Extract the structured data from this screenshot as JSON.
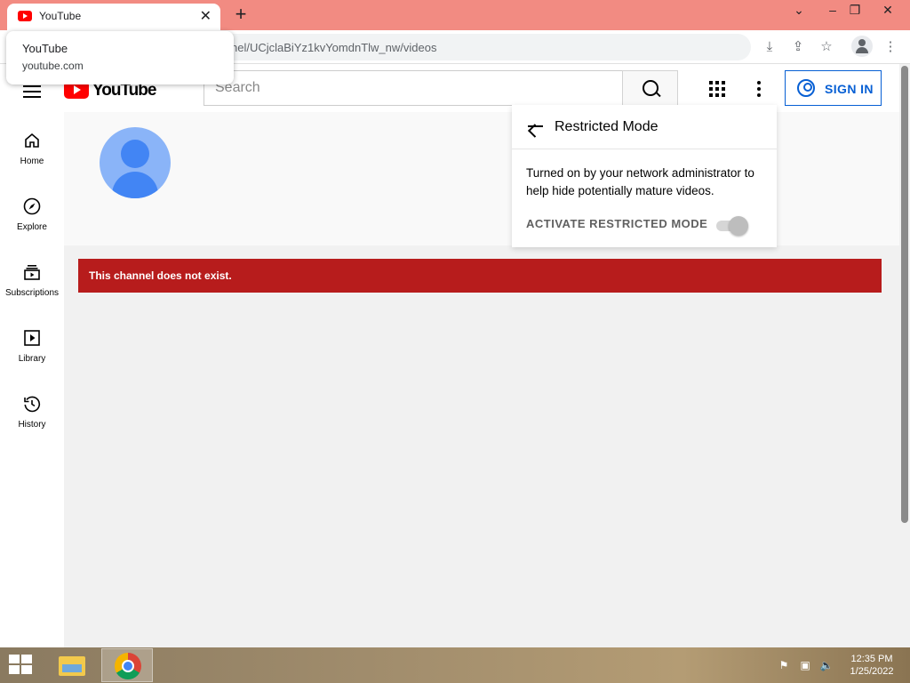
{
  "browser": {
    "tab_title": "YouTube",
    "url": "nel/UCjclaBiYz1kvYomdnTlw_nw/videos"
  },
  "tooltip": {
    "title": "YouTube",
    "subtitle": "youtube.com"
  },
  "header": {
    "wordmark": "YouTube",
    "search_placeholder": "Search",
    "signin_label": "SIGN IN"
  },
  "guide": {
    "items": [
      {
        "label": "Home",
        "icon": "home-icon"
      },
      {
        "label": "Explore",
        "icon": "compass-icon"
      },
      {
        "label": "Subscriptions",
        "icon": "subscriptions-icon"
      },
      {
        "label": "Library",
        "icon": "library-icon"
      },
      {
        "label": "History",
        "icon": "history-icon"
      }
    ]
  },
  "channel": {
    "error_message": "This channel does not exist."
  },
  "restricted_popup": {
    "title": "Restricted Mode",
    "description": "Turned on by your network administrator to help hide potentially mature videos.",
    "activate_label": "ACTIVATE RESTRICTED MODE",
    "enabled": true
  },
  "taskbar": {
    "time": "12:35 PM",
    "date": "1/25/2022"
  },
  "colors": {
    "titlebar": "#f28b82",
    "error_banner": "#b71c1c",
    "link_blue": "#065fd4",
    "yt_red": "#ff0000"
  }
}
